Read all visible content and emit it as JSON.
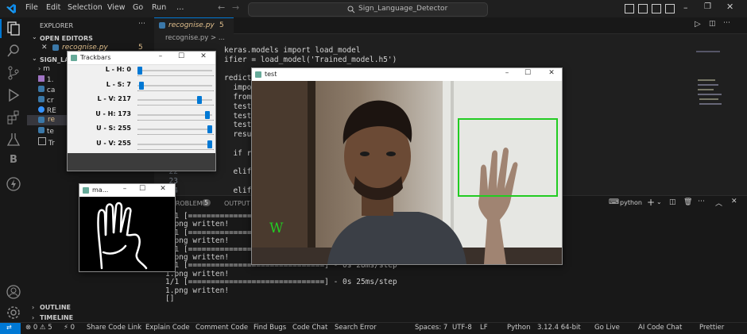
{
  "app": {
    "menu": [
      "File",
      "Edit",
      "Selection",
      "View",
      "Go",
      "Run",
      "…"
    ],
    "search_text": "Sign_Language_Detector"
  },
  "sidebar": {
    "explorer_title": "EXPLORER",
    "open_editors": "OPEN EDITORS",
    "open_editor_file": "recognise.py",
    "open_editor_badge": "5",
    "project": "SIGN_LA",
    "files": [
      "m",
      "1.",
      "ca",
      "cr",
      "RE",
      "re",
      "te",
      "Tr"
    ],
    "outline": "OUTLINE",
    "timeline": "TIMELINE"
  },
  "editor": {
    "tab_label": "recognise.py",
    "tab_badge": "5",
    "breadcrumb": "recognise.py > ...",
    "code_lines": [
      {
        "n": "",
        "text": "keras.models import load_model"
      },
      {
        "n": "",
        "text": "ifier = load_model('Trained_model.h5')"
      },
      {
        "n": "",
        "text": ""
      },
      {
        "n": "",
        "text": "redictor():"
      },
      {
        "n": "",
        "text": "  import"
      },
      {
        "n": "",
        "text": "  from k"
      },
      {
        "n": "",
        "text": "  test_i"
      },
      {
        "n": "",
        "text": "  test_i"
      },
      {
        "n": "",
        "text": "  test_i"
      },
      {
        "n": "",
        "text": "  result"
      },
      {
        "n": "",
        "text": ""
      },
      {
        "n": "",
        "text": "  if res"
      },
      {
        "n": "",
        "text": ""
      },
      {
        "n": "22",
        "text": "  elif r"
      },
      {
        "n": "23",
        "text": ""
      },
      {
        "n": "24",
        "text": "  elif r"
      }
    ]
  },
  "panel": {
    "tabs": [
      "PROBLEMS",
      "OUTPUT"
    ],
    "problems_count": "5",
    "terminal_shell": "python",
    "terminal_lines": [
      "1/1 [==============================] - 0s 28ms/step",
      "1.png written!",
      "1/1 [==============================] - 0s 28ms/step",
      "1.png written!",
      "1/1 [==============================] - 0s 28ms/step",
      "1.png written!",
      "1/1 [==============================] - 0s 28ms/step",
      "1.png written!",
      "1/1 [==============================] - 0s 25ms/step",
      "1.png written!",
      "[]"
    ]
  },
  "trackbars": {
    "title": "Trackbars",
    "items": [
      {
        "label": "L - H: 0",
        "value": 0,
        "max": 179
      },
      {
        "label": "L - S: 7",
        "value": 7,
        "max": 255
      },
      {
        "label": "L - V: 217",
        "value": 217,
        "max": 255
      },
      {
        "label": "U - H: 173",
        "value": 173,
        "max": 179
      },
      {
        "label": "U - S: 255",
        "value": 255,
        "max": 255
      },
      {
        "label": "U - V: 255",
        "value": 255,
        "max": 255
      }
    ]
  },
  "mask_window": {
    "title": "ma..."
  },
  "test_window": {
    "title": "test",
    "prediction": "W"
  },
  "statusbar": {
    "left": [
      "⊗ 0 ⚠ 5",
      "⚡ 0",
      "Share Code Link",
      "Explain Code",
      "Comment Code",
      "Find Bugs",
      "Code Chat",
      "Search Error"
    ],
    "right": [
      "Spaces: 7",
      "UTF-8",
      "LF",
      "Python",
      "3.12.4 64-bit",
      "Go Live",
      "AI Code Chat",
      "Prettier"
    ]
  },
  "colors": {
    "accent": "#0078d4",
    "detection_box": "#22cc22",
    "prediction_text": "#22cc22"
  }
}
